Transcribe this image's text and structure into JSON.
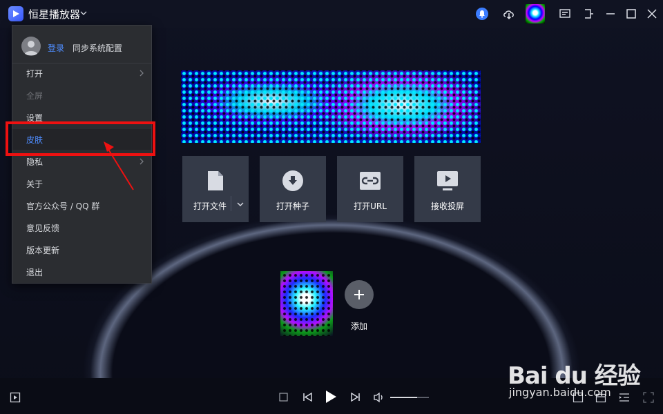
{
  "app": {
    "title": "恒星播放器"
  },
  "menu": {
    "login": "登录",
    "sync": "同步系统配置",
    "items": [
      {
        "label": "打开",
        "submenu": true,
        "disabled": false
      },
      {
        "label": "全屏",
        "submenu": false,
        "disabled": true
      },
      {
        "label": "设置",
        "submenu": false,
        "disabled": false
      },
      {
        "label": "皮肤",
        "submenu": false,
        "disabled": false,
        "highlighted": true
      },
      {
        "label": "隐私",
        "submenu": true,
        "disabled": false
      },
      {
        "label": "关于",
        "submenu": false,
        "disabled": false
      },
      {
        "label": "官方公众号 / QQ 群",
        "submenu": false,
        "disabled": false
      },
      {
        "label": "意见反馈",
        "submenu": false,
        "disabled": false
      },
      {
        "label": "版本更新",
        "submenu": false,
        "disabled": false
      },
      {
        "label": "退出",
        "submenu": false,
        "disabled": false
      }
    ]
  },
  "actions": [
    {
      "label": "打开文件",
      "icon": "file-icon"
    },
    {
      "label": "打开种子",
      "icon": "download-circle-icon"
    },
    {
      "label": "打开URL",
      "icon": "link-icon"
    },
    {
      "label": "接收投屏",
      "icon": "cast-screen-icon"
    }
  ],
  "recent": {
    "add_label": "添加"
  },
  "watermark": {
    "brand": "Bai du 经验",
    "url": "jingyan.baidu.com"
  },
  "player": {
    "volume_level": 0.7
  },
  "colors": {
    "accent": "#4f8dff",
    "annotation": "#ee1111",
    "tile": "#343a48",
    "menu_bg": "#2b2d31"
  }
}
